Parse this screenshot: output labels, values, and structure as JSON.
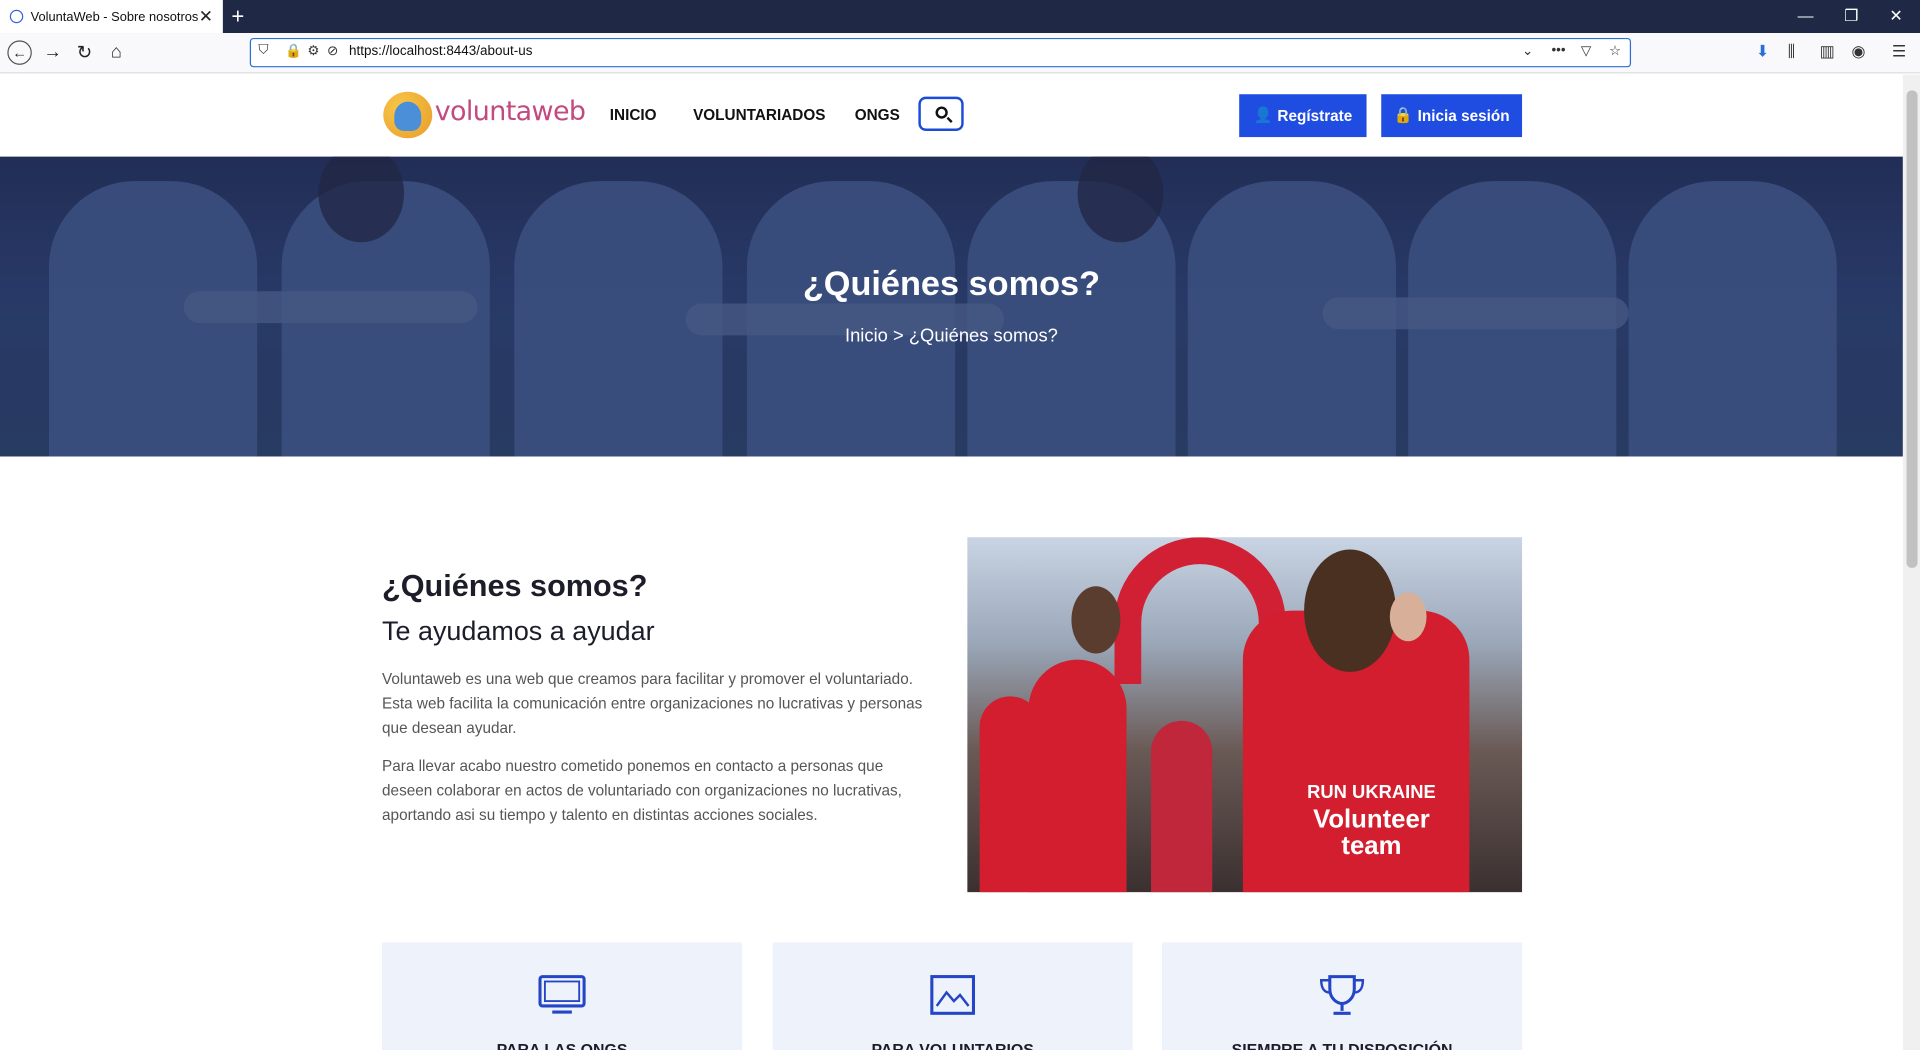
{
  "browser": {
    "tab_title": "VoluntaWeb - Sobre nosotros",
    "url": "https://localhost:8443/about-us"
  },
  "header": {
    "logo_text": "voluntaweb",
    "nav": [
      "INICIO",
      "VOLUNTARIADOS",
      "ONGS"
    ],
    "register_label": "Regístrate",
    "login_label": "Inicia sesión",
    "accent": "#1f4de2"
  },
  "hero": {
    "title": "¿Quiénes somos?",
    "breadcrumb_home": "Inicio",
    "breadcrumb_sep": ">",
    "breadcrumb_current": "¿Quiénes somos?"
  },
  "about": {
    "heading": "¿Quiénes somos?",
    "subheading": "Te ayudamos a ayudar",
    "p1_lines": [
      "Voluntaweb es una web que creamos para facilitar y promover el voluntariado.",
      "Esta web facilita la comunicación entre organizaciones no lucrativas y personas",
      "que desean ayudar."
    ],
    "p2_lines": [
      "Para llevar acabo nuestro cometido ponemos en contacto a personas que",
      "deseen colaborar en actos de voluntariado con organizaciones no lucrativas,",
      "aportando asi su tiempo y talento en distintas acciones sociales."
    ],
    "photo_shirt_brand": "RUN UKRAINE",
    "photo_shirt_text": "Volunteer team"
  },
  "cards": [
    {
      "icon": "monitor-icon",
      "title": "PARA LAS ONGS"
    },
    {
      "icon": "image-icon",
      "title": "PARA VOLUNTARIOS"
    },
    {
      "icon": "trophy-icon",
      "title": "SIEMPRE A TU DISPOSICIÓN"
    }
  ]
}
